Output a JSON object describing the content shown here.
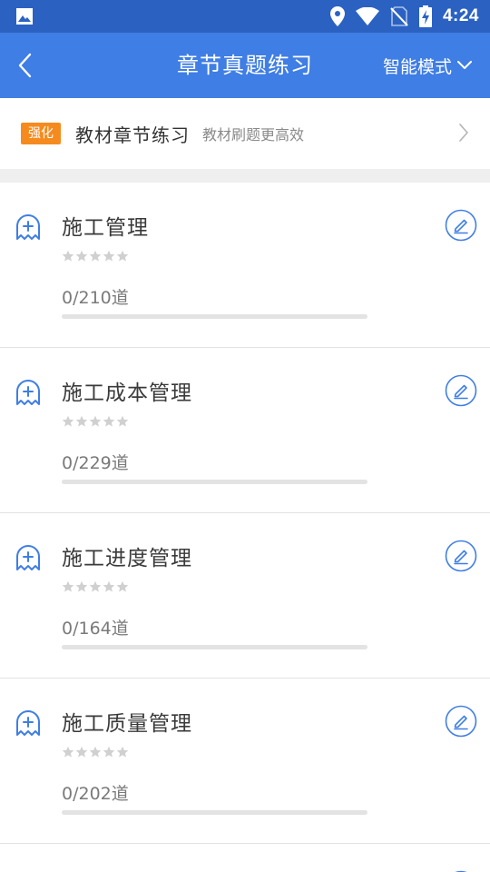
{
  "status_bar": {
    "time": "4:24",
    "icons": [
      "image-icon",
      "location-icon",
      "wifi-icon",
      "no-sim-icon",
      "battery-charging-icon"
    ]
  },
  "header": {
    "title": "章节真题练习",
    "mode_label": "智能模式",
    "back_icon": "back-arrow-icon",
    "mode_icon": "chevron-down-icon"
  },
  "banner": {
    "badge": "强化",
    "title": "教材章节练习",
    "subtitle": "教材刷题更高效",
    "arrow_icon": "chevron-right-icon"
  },
  "chapters": [
    {
      "title": "施工管理",
      "count": "0/210道",
      "stars": 0,
      "progress": 0
    },
    {
      "title": "施工成本管理",
      "count": "0/229道",
      "stars": 0,
      "progress": 0
    },
    {
      "title": "施工进度管理",
      "count": "0/164道",
      "stars": 0,
      "progress": 0
    },
    {
      "title": "施工质量管理",
      "count": "0/202道",
      "stars": 0,
      "progress": 0
    }
  ],
  "colors": {
    "status_bar": "#2b62c2",
    "app_bar": "#3f7ee4",
    "badge": "#f58b1f",
    "accent": "#3f7ee4",
    "star_empty": "#d0d0d0",
    "progress_track": "#e3e3e3"
  }
}
